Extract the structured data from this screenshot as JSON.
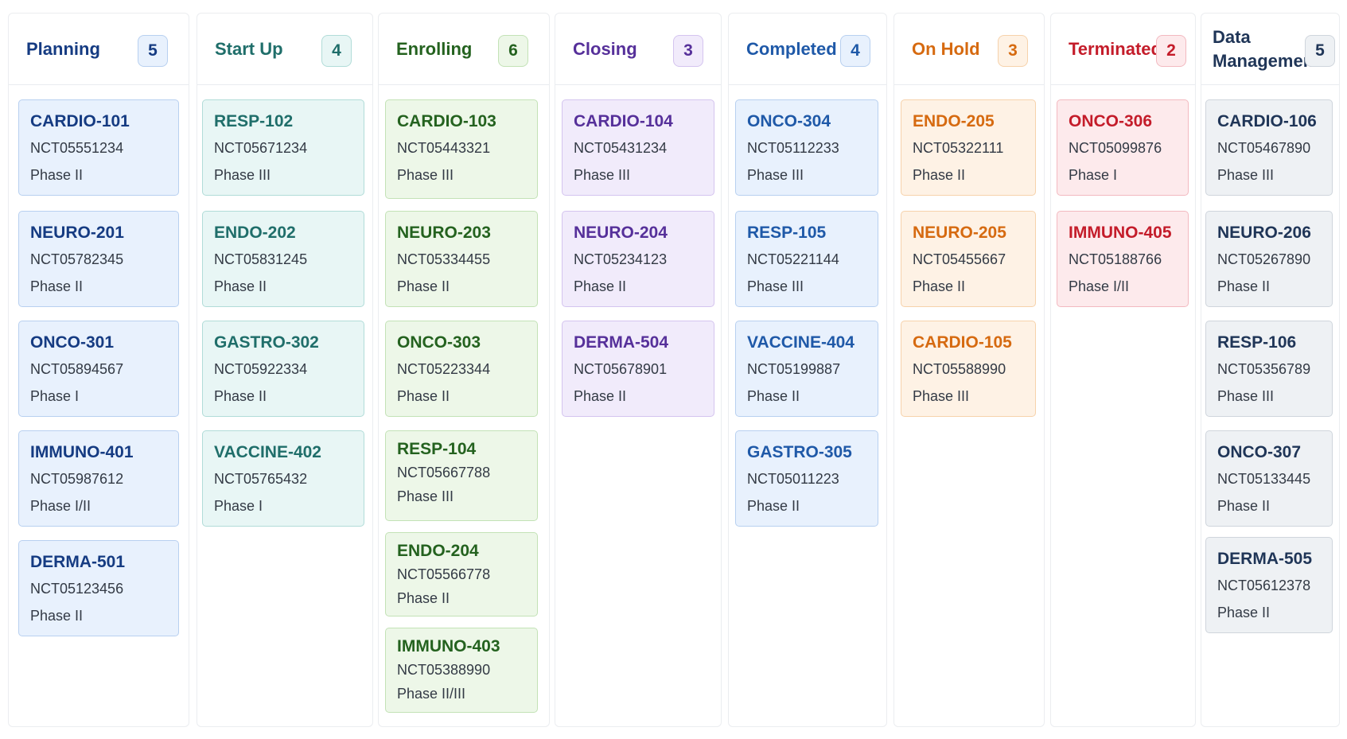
{
  "columns": [
    {
      "title": "Planning",
      "count": "5",
      "colors": {
        "title": "#153b82",
        "card_bg": "#e8f1fd",
        "card_border": "#b8d0f0",
        "badge_bg": "#e8f1fd",
        "badge_border": "#b8d0f0"
      },
      "cards": [
        {
          "code": "CARDIO-101",
          "nct": "NCT05551234",
          "phase": "Phase II"
        },
        {
          "code": "NEURO-201",
          "nct": "NCT05782345",
          "phase": "Phase II"
        },
        {
          "code": "ONCO-301",
          "nct": "NCT05894567",
          "phase": "Phase I"
        },
        {
          "code": "IMMUNO-401",
          "nct": "NCT05987612",
          "phase": "Phase I/II"
        },
        {
          "code": "DERMA-501",
          "nct": "NCT05123456",
          "phase": "Phase II"
        }
      ]
    },
    {
      "title": "Start Up",
      "count": "4",
      "colors": {
        "title": "#1f6e6a",
        "card_bg": "#e8f6f5",
        "card_border": "#b1dcd8",
        "badge_bg": "#e8f6f5",
        "badge_border": "#b1dcd8"
      },
      "cards": [
        {
          "code": "RESP-102",
          "nct": "NCT05671234",
          "phase": "Phase III"
        },
        {
          "code": "ENDO-202",
          "nct": "NCT05831245",
          "phase": "Phase II"
        },
        {
          "code": "GASTRO-302",
          "nct": "NCT05922334",
          "phase": "Phase II"
        },
        {
          "code": "VACCINE-402",
          "nct": "NCT05765432",
          "phase": "Phase I"
        }
      ]
    },
    {
      "title": "Enrolling",
      "count": "6",
      "colors": {
        "title": "#24621f",
        "card_bg": "#edf7e8",
        "card_border": "#c3e2b6",
        "badge_bg": "#edf7e8",
        "badge_border": "#c3e2b6"
      },
      "cards": [
        {
          "code": "CARDIO-103",
          "nct": "NCT05443321",
          "phase": "Phase III"
        },
        {
          "code": "NEURO-203",
          "nct": "NCT05334455",
          "phase": "Phase II"
        },
        {
          "code": "ONCO-303",
          "nct": "NCT05223344",
          "phase": "Phase II"
        },
        {
          "code": "RESP-104",
          "nct": "NCT05667788",
          "phase": "Phase III"
        },
        {
          "code": "ENDO-204",
          "nct": "NCT05566778",
          "phase": "Phase II"
        },
        {
          "code": "IMMUNO-403",
          "nct": "NCT05388990",
          "phase": "Phase II/III"
        }
      ]
    },
    {
      "title": "Closing",
      "count": "3",
      "colors": {
        "title": "#56309a",
        "card_bg": "#f1ebfb",
        "card_border": "#d4c4ef",
        "badge_bg": "#f1ebfb",
        "badge_border": "#d4c4ef"
      },
      "cards": [
        {
          "code": "CARDIO-104",
          "nct": "NCT05431234",
          "phase": "Phase III"
        },
        {
          "code": "NEURO-204",
          "nct": "NCT05234123",
          "phase": "Phase II"
        },
        {
          "code": "DERMA-504",
          "nct": "NCT05678901",
          "phase": "Phase II"
        }
      ]
    },
    {
      "title": "Completed",
      "count": "4",
      "colors": {
        "title": "#1f59a8",
        "card_bg": "#e8f1fd",
        "card_border": "#b8d0f0",
        "badge_bg": "#e8f1fd",
        "badge_border": "#b8d0f0"
      },
      "cards": [
        {
          "code": "ONCO-304",
          "nct": "NCT05112233",
          "phase": "Phase III"
        },
        {
          "code": "RESP-105",
          "nct": "NCT05221144",
          "phase": "Phase III"
        },
        {
          "code": "VACCINE-404",
          "nct": "NCT05199887",
          "phase": "Phase II"
        },
        {
          "code": "GASTRO-305",
          "nct": "NCT05011223",
          "phase": "Phase II"
        }
      ]
    },
    {
      "title": "On Hold",
      "count": "3",
      "colors": {
        "title": "#d66a10",
        "card_bg": "#fef2e5",
        "card_border": "#f6d2ab",
        "badge_bg": "#fef2e5",
        "badge_border": "#f6d2ab"
      },
      "cards": [
        {
          "code": "ENDO-205",
          "nct": "NCT05322111",
          "phase": "Phase II"
        },
        {
          "code": "NEURO-205",
          "nct": "NCT05455667",
          "phase": "Phase II"
        },
        {
          "code": "CARDIO-105",
          "nct": "NCT05588990",
          "phase": "Phase III"
        }
      ]
    },
    {
      "title": "Terminated",
      "count": "2",
      "colors": {
        "title": "#c41c2a",
        "card_bg": "#fdeaec",
        "card_border": "#f3b9c0",
        "badge_bg": "#fdeaec",
        "badge_border": "#f3b9c0"
      },
      "cards": [
        {
          "code": "ONCO-306",
          "nct": "NCT05099876",
          "phase": "Phase I"
        },
        {
          "code": "IMMUNO-405",
          "nct": "NCT05188766",
          "phase": "Phase I/II"
        }
      ]
    },
    {
      "title": "Data Management",
      "count": "5",
      "colors": {
        "title": "#1f3557",
        "card_bg": "#eef1f4",
        "card_border": "#cfd5dc",
        "badge_bg": "#eef1f4",
        "badge_border": "#cfd5dc"
      },
      "cards": [
        {
          "code": "CARDIO-106",
          "nct": "NCT05467890",
          "phase": "Phase III"
        },
        {
          "code": "NEURO-206",
          "nct": "NCT05267890",
          "phase": "Phase II"
        },
        {
          "code": "RESP-106",
          "nct": "NCT05356789",
          "phase": "Phase III"
        },
        {
          "code": "ONCO-307",
          "nct": "NCT05133445",
          "phase": "Phase II"
        },
        {
          "code": "DERMA-505",
          "nct": "NCT05612378",
          "phase": "Phase II"
        }
      ]
    }
  ]
}
